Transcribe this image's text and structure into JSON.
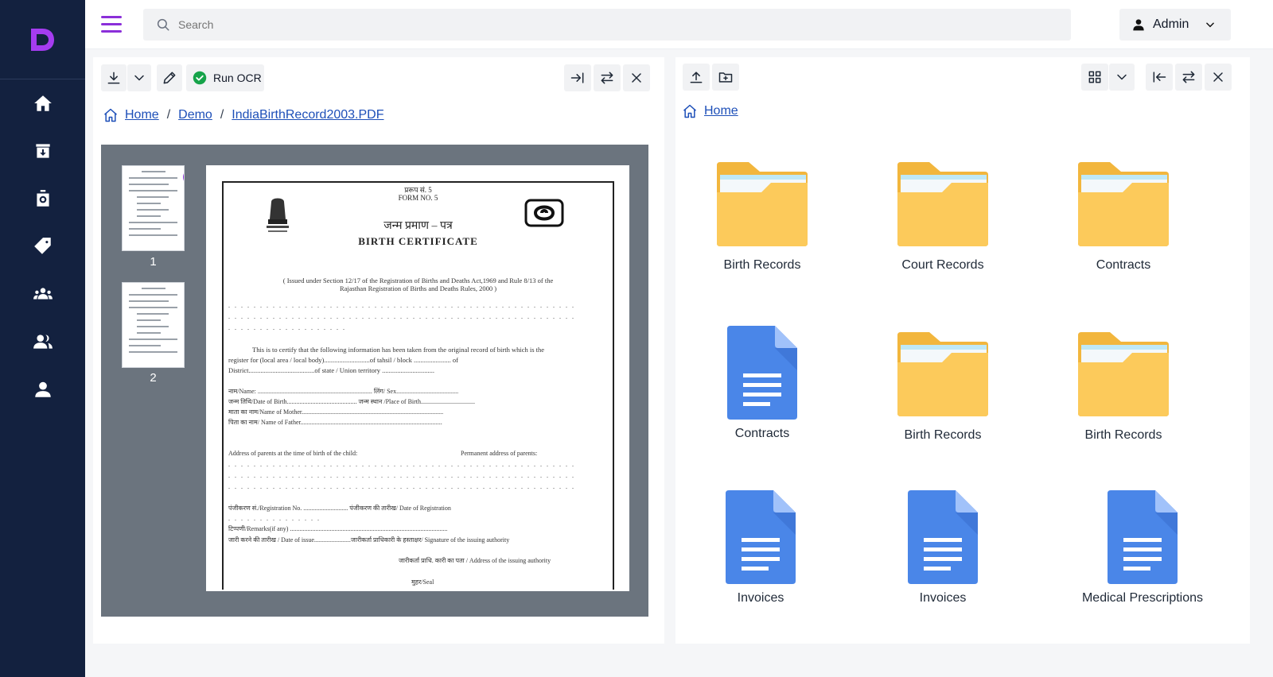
{
  "search": {
    "placeholder": "Search"
  },
  "user": {
    "name": "Admin"
  },
  "viewer_toolbar": {
    "run_ocr": "Run OCR"
  },
  "viewer_breadcrumb": [
    "Home",
    "Demo",
    "IndiaBirthRecord2003.PDF"
  ],
  "browser_breadcrumb": [
    "Home"
  ],
  "thumbnails": [
    "1",
    "2"
  ],
  "document": {
    "form_hindi": "प्ररूप सं. 5",
    "form_no": "FORM NO. 5",
    "title_hindi": "जन्म प्रमाण – पत्र",
    "title": "BIRTH CERTIFICATE",
    "issued_under": "( Issued under Section 12/17 of the Registration of Births and Deaths Act,1969 and Rule 8/13 of the",
    "rules": "Rajasthan Registration of Births and Deaths Rules, 2000 )",
    "certify": "This is to certify that the following information has been taken from the original record of birth which is the",
    "register": "register for (local area / local body)...........................of tahsil / block ...................... of",
    "district": "District.......................................of state / Union territory ...............................",
    "name": "नाम/Name: ........................................................................ लिंग/ Sex.......................................",
    "dob": "जन्म तिथि/Date of Birth............................................ जन्म स्थान /Place of Birth..................................",
    "mother": "माता का नाम/Name of Mother.........................................................................................",
    "father": "पिता का नाम/ Name of Father.........................................................................................",
    "addr_birth": "Address of parents at the time of birth of the child:",
    "addr_perm": "Permanent address of parents:",
    "reg_no": "पंजीकरण सं./Registration No. ............................ पंजीकरण की तारीख/ Date of Registration",
    "remarks": "टिप्पणी/Remarks(if any) ...................................................................................................",
    "issue": "जारी करने की तारीख / Date of issue.......................जारीकर्ता प्राधिकारी के हस्ताक्षर/ Signature of the issuing authority",
    "authority": "जारीकर्ता प्राधि. कारी का पता / Address of the issuing authority",
    "seal": "मुहर/Seal"
  },
  "files": [
    {
      "name": "Birth Records",
      "type": "folder"
    },
    {
      "name": "Court Records",
      "type": "folder"
    },
    {
      "name": "Contracts",
      "type": "folder"
    },
    {
      "name": "Contracts",
      "type": "doc"
    },
    {
      "name": "Birth Records",
      "type": "folder"
    },
    {
      "name": "Birth Records",
      "type": "folder"
    },
    {
      "name": "Invoices",
      "type": "doc"
    },
    {
      "name": "Invoices",
      "type": "doc"
    },
    {
      "name": "Medical Prescriptions",
      "type": "doc"
    }
  ],
  "colors": {
    "sidebar": "#13213f",
    "accent": "#8b2fd9",
    "link": "#1d4fb8",
    "folder": "#fcca5b",
    "doc": "#4a86e8"
  }
}
